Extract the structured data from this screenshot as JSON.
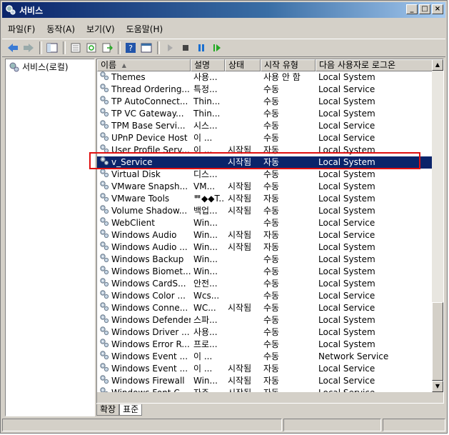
{
  "window": {
    "title": "서비스",
    "controls": [
      "_",
      "□",
      "×"
    ]
  },
  "menu": [
    "파일(F)",
    "동작(A)",
    "보기(V)",
    "도움말(H)"
  ],
  "toolbar": [
    "back-icon",
    "forward-icon",
    "sep",
    "show-hide-tree-icon",
    "sep",
    "properties-icon",
    "refresh-icon",
    "export-icon",
    "sep",
    "help-icon",
    "console-icon",
    "sep",
    "start-icon",
    "stop-icon",
    "pause-icon",
    "resume-icon"
  ],
  "tree": {
    "root_label": "서비스(로컬)"
  },
  "columns": [
    "이름",
    "설명",
    "상태",
    "시작 유형",
    "다음 사용자로 로그온"
  ],
  "rows": [
    {
      "name": "Themes",
      "desc": "사용...",
      "status": "",
      "startup": "사용 안 함",
      "logon": "Local System"
    },
    {
      "name": "Thread Ordering...",
      "desc": "특정...",
      "status": "",
      "startup": "수동",
      "logon": "Local Service"
    },
    {
      "name": "TP AutoConnect...",
      "desc": "Thin...",
      "status": "",
      "startup": "수동",
      "logon": "Local System"
    },
    {
      "name": "TP VC Gateway...",
      "desc": "Thin...",
      "status": "",
      "startup": "수동",
      "logon": "Local System"
    },
    {
      "name": "TPM Base Servi...",
      "desc": "시스...",
      "status": "",
      "startup": "수동",
      "logon": "Local Service"
    },
    {
      "name": "UPnP Device Host",
      "desc": "이 ...",
      "status": "",
      "startup": "수동",
      "logon": "Local Service"
    },
    {
      "name": "User Profile Serv...",
      "desc": "이 ...",
      "status": "시작됨",
      "startup": "자동",
      "logon": "Local System"
    },
    {
      "name": "v_Service",
      "desc": "",
      "status": "시작됨",
      "startup": "자동",
      "logon": "Local System",
      "selected": true
    },
    {
      "name": "Virtual Disk",
      "desc": "디스...",
      "status": "",
      "startup": "수동",
      "logon": "Local System"
    },
    {
      "name": "VMware Snapsh...",
      "desc": "VM...",
      "status": "시작됨",
      "startup": "수동",
      "logon": "Local System"
    },
    {
      "name": "VMware Tools",
      "desc": "ᄈ◆◆T...",
      "status": "시작됨",
      "startup": "자동",
      "logon": "Local System"
    },
    {
      "name": "Volume Shadow...",
      "desc": "백업...",
      "status": "시작됨",
      "startup": "수동",
      "logon": "Local System"
    },
    {
      "name": "WebClient",
      "desc": "Win...",
      "status": "",
      "startup": "수동",
      "logon": "Local Service"
    },
    {
      "name": "Windows Audio",
      "desc": "Win...",
      "status": "시작됨",
      "startup": "자동",
      "logon": "Local Service"
    },
    {
      "name": "Windows Audio ...",
      "desc": "Win...",
      "status": "시작됨",
      "startup": "자동",
      "logon": "Local System"
    },
    {
      "name": "Windows Backup",
      "desc": "Win...",
      "status": "",
      "startup": "수동",
      "logon": "Local System"
    },
    {
      "name": "Windows Biomet...",
      "desc": "Win...",
      "status": "",
      "startup": "수동",
      "logon": "Local System"
    },
    {
      "name": "Windows CardS...",
      "desc": "안전...",
      "status": "",
      "startup": "수동",
      "logon": "Local System"
    },
    {
      "name": "Windows Color ...",
      "desc": "Wcs...",
      "status": "",
      "startup": "수동",
      "logon": "Local Service"
    },
    {
      "name": "Windows Conne...",
      "desc": "WC...",
      "status": "시작됨",
      "startup": "수동",
      "logon": "Local Service"
    },
    {
      "name": "Windows Defender",
      "desc": "스파...",
      "status": "",
      "startup": "수동",
      "logon": "Local System"
    },
    {
      "name": "Windows Driver ...",
      "desc": "사용...",
      "status": "",
      "startup": "수동",
      "logon": "Local System"
    },
    {
      "name": "Windows Error R...",
      "desc": "프로...",
      "status": "",
      "startup": "수동",
      "logon": "Local System"
    },
    {
      "name": "Windows Event ...",
      "desc": "이 ...",
      "status": "",
      "startup": "수동",
      "logon": "Network Service"
    },
    {
      "name": "Windows Event ...",
      "desc": "이 ...",
      "status": "시작됨",
      "startup": "자동",
      "logon": "Local Service"
    },
    {
      "name": "Windows Firewall",
      "desc": "Win...",
      "status": "시작됨",
      "startup": "자동",
      "logon": "Local Service"
    },
    {
      "name": "Windows Font C...",
      "desc": "자주...",
      "status": "시작됨",
      "startup": "자동",
      "logon": "Local Service"
    }
  ],
  "tabs": [
    "확장",
    "표준"
  ],
  "active_tab": "표준",
  "colors": {
    "selection": "#0a246a",
    "highlight_box": "#e01010",
    "title_gradient_start": "#0a246a"
  }
}
